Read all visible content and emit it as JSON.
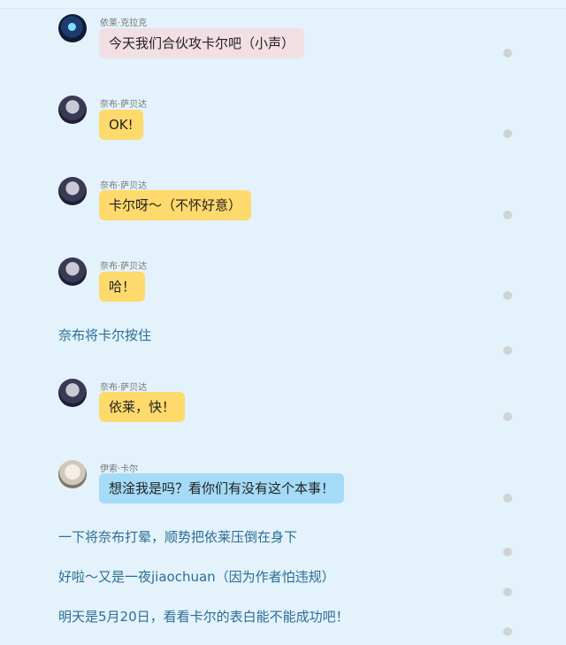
{
  "chat": [
    {
      "sender": "依莱·克拉克",
      "text": "今天我们合伙攻卡尔吧（小声）",
      "avatar": "avatar-ilay"
    },
    {
      "sender": "奈布·萨贝达",
      "text": "OK!",
      "avatar": "avatar-naib"
    },
    {
      "sender": "奈布·萨贝达",
      "text": "卡尔呀～（不怀好意）",
      "avatar": "avatar-naib"
    },
    {
      "sender": "奈布·萨贝达",
      "text": "哈！",
      "avatar": "avatar-naib"
    },
    {
      "sender": "奈布·萨贝达",
      "text": "依莱，快！",
      "avatar": "avatar-naib"
    },
    {
      "sender": "伊索·卡尔",
      "text": "想淦我是吗？看你们有没有这个本事！",
      "avatar": "avatar-aesop"
    }
  ],
  "narration": [
    "奈布将卡尔按住",
    "一下将奈布打晕，顺势把依莱压倒在身下",
    "好啦～又是一夜jiaochuan（因为作者怕违规）",
    "明天是5月20日，看看卡尔的表白能不能成功吧！"
  ],
  "colors": {
    "background": "#e3f2fb",
    "pink_bubble": "#f1dfe3",
    "yellow_bubble": "#fed96b",
    "blue_bubble": "#a4dbf6",
    "narration_text": "#2c6e93"
  }
}
